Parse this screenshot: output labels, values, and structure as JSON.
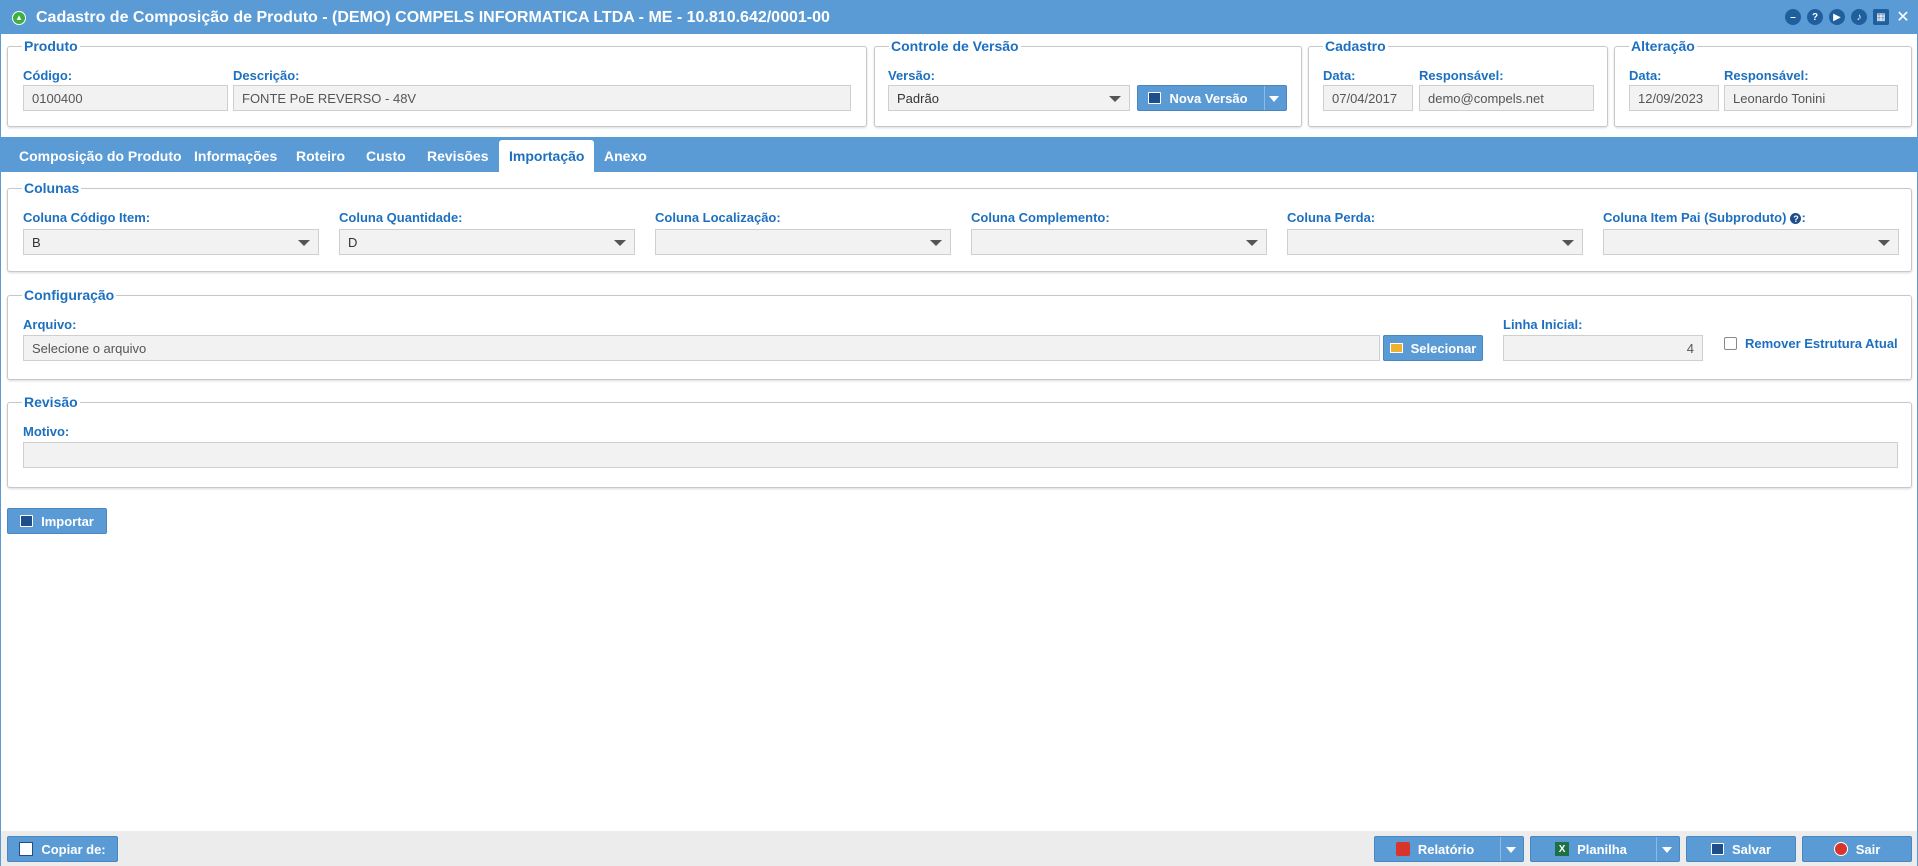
{
  "window": {
    "title": "Cadastro de Composição de Produto - (DEMO) COMPELS INFORMATICA LTDA - ME - 10.810.642/0001-00"
  },
  "produto": {
    "legend": "Produto",
    "codigo_label": "Código:",
    "codigo_value": "0100400",
    "descricao_label": "Descrição:",
    "descricao_value": "FONTE PoE REVERSO - 48V"
  },
  "versao": {
    "legend": "Controle de Versão",
    "versao_label": "Versão:",
    "versao_value": "Padrão",
    "nova_versao_label": "Nova Versão"
  },
  "cadastro": {
    "legend": "Cadastro",
    "data_label": "Data:",
    "data_value": "07/04/2017",
    "resp_label": "Responsável:",
    "resp_value": "demo@compels.net"
  },
  "alteracao": {
    "legend": "Alteração",
    "data_label": "Data:",
    "data_value": "12/09/2023",
    "resp_label": "Responsável:",
    "resp_value": "Leonardo Tonini"
  },
  "tabs": [
    {
      "label": "Composição do Produto"
    },
    {
      "label": "Informações"
    },
    {
      "label": "Roteiro"
    },
    {
      "label": "Custo"
    },
    {
      "label": "Revisões"
    },
    {
      "label": "Importação"
    },
    {
      "label": "Anexo"
    }
  ],
  "colunas": {
    "legend": "Colunas",
    "fields": [
      {
        "label": "Coluna Código Item:",
        "value": "B"
      },
      {
        "label": "Coluna Quantidade:",
        "value": "D"
      },
      {
        "label": "Coluna Localização:",
        "value": ""
      },
      {
        "label": "Coluna Complemento:",
        "value": ""
      },
      {
        "label": "Coluna Perda:",
        "value": ""
      },
      {
        "label": "Coluna Item Pai (Subproduto)",
        "value": ""
      }
    ],
    "label_suffix": ":"
  },
  "configuracao": {
    "legend": "Configuração",
    "arquivo_label": "Arquivo:",
    "arquivo_placeholder": "Selecione o arquivo",
    "selecionar_label": "Selecionar",
    "linha_label": "Linha Inicial:",
    "linha_value": "4",
    "remover_label": "Remover Estrutura Atual"
  },
  "revisao": {
    "legend": "Revisão",
    "motivo_label": "Motivo:",
    "motivo_value": ""
  },
  "actions": {
    "importar": "Importar",
    "copiar": "Copiar de:",
    "relatorio": "Relatório",
    "planilha": "Planilha",
    "salvar": "Salvar",
    "sair": "Sair"
  },
  "colors": {
    "accent": "#5b9bd5",
    "label": "#1d70c0"
  }
}
